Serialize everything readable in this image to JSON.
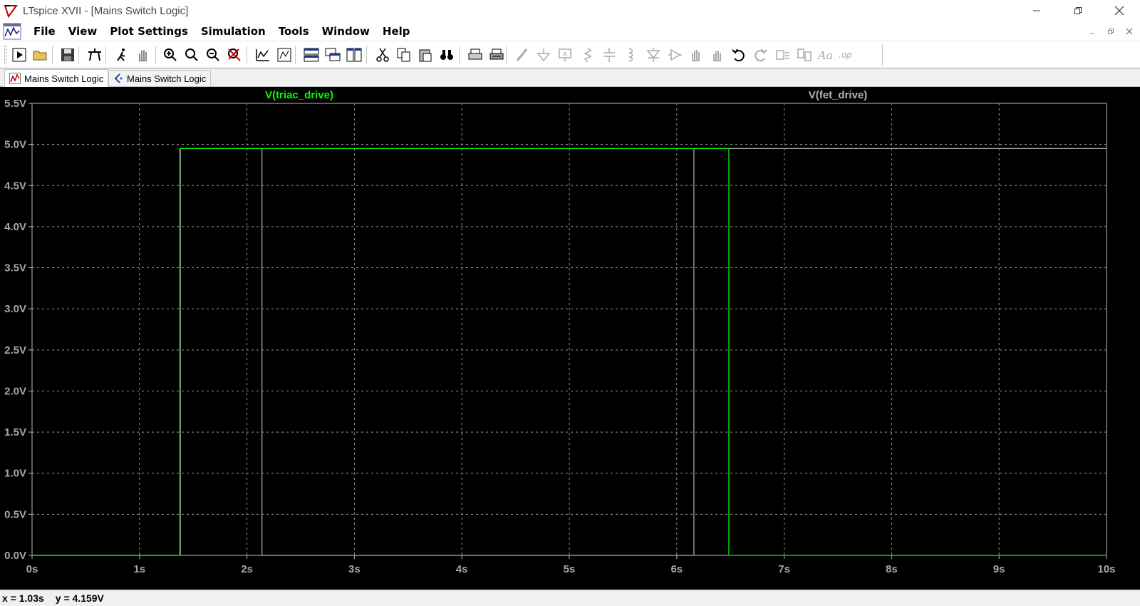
{
  "window": {
    "title": "LTspice XVII - [Mains Switch Logic]",
    "icon": "ltspice-logo-icon",
    "controls": [
      "minimize-icon",
      "restore-icon",
      "close-icon"
    ]
  },
  "menu": {
    "items": [
      "File",
      "View",
      "Plot Settings",
      "Simulation",
      "Tools",
      "Window",
      "Help"
    ],
    "mdi_controls": [
      "mdi-minimize-icon",
      "mdi-restore-icon",
      "mdi-close-icon"
    ]
  },
  "toolbar": {
    "icons": [
      "run-icon",
      "open-icon",
      "save-icon",
      "control-panel-icon",
      "run-sim-icon",
      "pan-hand-icon",
      "zoom-in-icon",
      "zoom-area-icon",
      "zoom-out-icon",
      "zoom-cancel-icon",
      "autorange-icon",
      "pick-visible-icon",
      "tile-horizontal-icon",
      "cascade-icon",
      "tile-vertical-icon",
      "cut-icon",
      "copy-icon",
      "paste-icon",
      "find-icon",
      "print-icon",
      "print-setup-icon",
      "draw-wire-icon",
      "ground-icon",
      "label-net-icon",
      "resistor-icon",
      "capacitor-icon",
      "inductor-icon",
      "diode-icon",
      "component-icon",
      "move-icon",
      "drag-icon",
      "undo-icon",
      "redo-icon",
      "rotate-icon",
      "mirror-icon",
      "text-icon",
      "spice-directive-icon"
    ]
  },
  "tabs": [
    {
      "label": "Mains Switch Logic",
      "kind": "waveform",
      "active": true
    },
    {
      "label": "Mains Switch Logic",
      "kind": "schematic",
      "active": false
    }
  ],
  "chart_data": {
    "type": "line",
    "xlim": [
      0,
      10
    ],
    "ylim": [
      0,
      5.5
    ],
    "x_ticks": [
      0,
      1,
      2,
      3,
      4,
      5,
      6,
      7,
      8,
      9,
      10
    ],
    "x_tick_labels": [
      "0s",
      "1s",
      "2s",
      "3s",
      "4s",
      "5s",
      "6s",
      "7s",
      "8s",
      "9s",
      "10s"
    ],
    "y_ticks": [
      0,
      0.5,
      1,
      1.5,
      2,
      2.5,
      3,
      3.5,
      4,
      4.5,
      5,
      5.5
    ],
    "y_tick_labels": [
      "0.0V",
      "0.5V",
      "1.0V",
      "1.5V",
      "2.0V",
      "2.5V",
      "3.0V",
      "3.5V",
      "4.0V",
      "4.5V",
      "5.0V",
      "5.5V"
    ],
    "grid": true,
    "series": [
      {
        "name": "V(triac_drive)",
        "color": "#00ff00",
        "x": [
          0,
          1.375,
          1.375,
          6.485,
          6.485,
          10
        ],
        "y": [
          0,
          0,
          4.95,
          4.95,
          0,
          0
        ]
      },
      {
        "name": "V(fet_drive)",
        "color": "#b4b4b4",
        "x": [
          0,
          1.38,
          1.38,
          2.14,
          2.14,
          6.16,
          6.16,
          10
        ],
        "y": [
          0,
          0,
          4.95,
          4.95,
          0,
          0,
          4.95,
          4.95
        ]
      }
    ]
  },
  "status": {
    "x_readout": "x = 1.03s",
    "y_readout": "y = 4.159V"
  },
  "colors": {
    "plot_background": "#000000",
    "grid": "#9a9a9a",
    "axis_labels": "#a8a8a8"
  }
}
